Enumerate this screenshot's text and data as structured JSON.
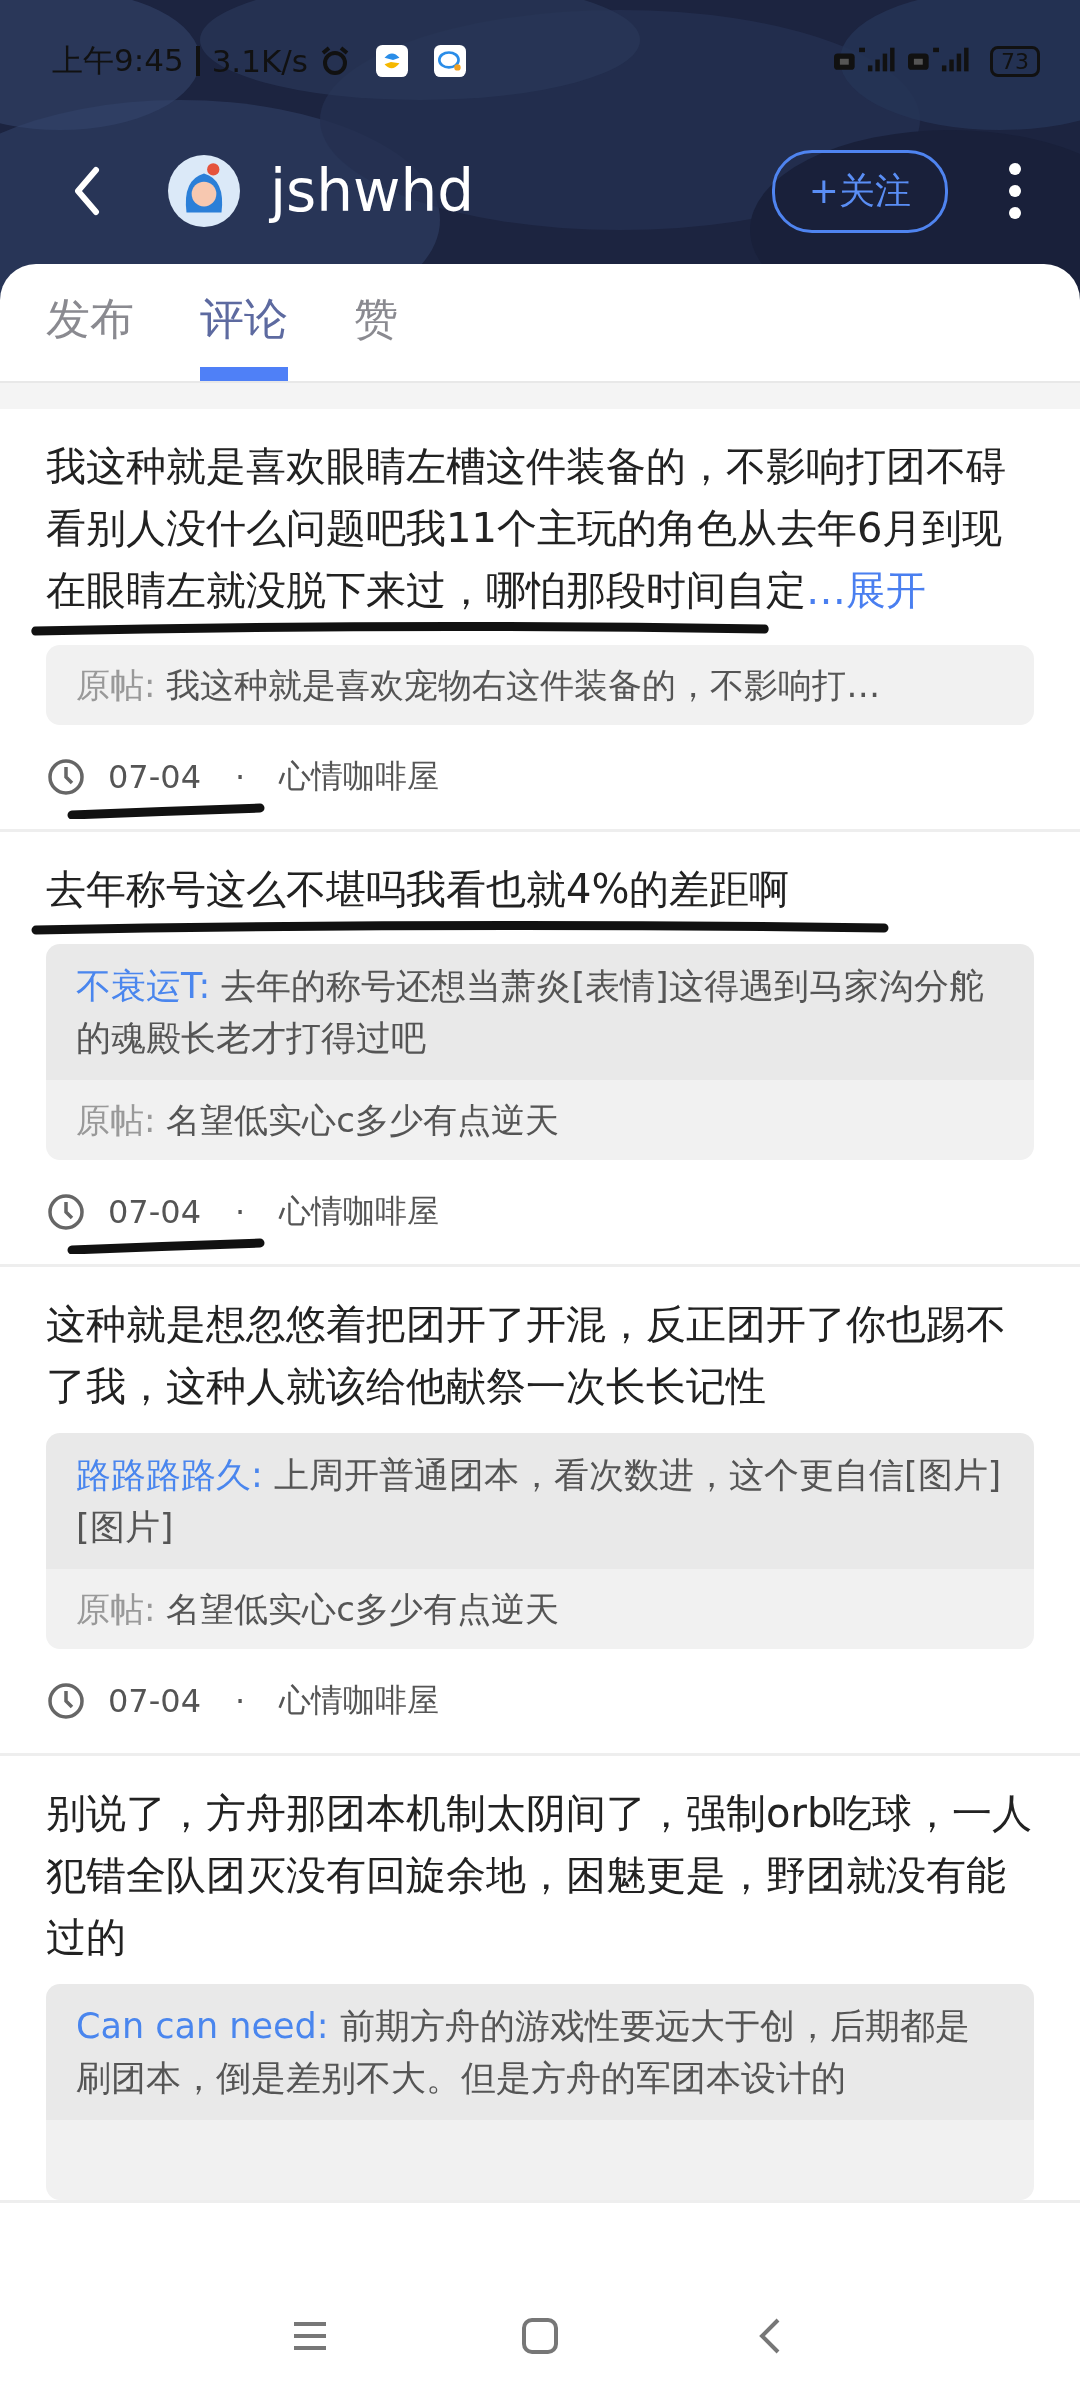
{
  "status_bar": {
    "time": "上午9:45",
    "speed": "3.1K/s",
    "battery": "73"
  },
  "header": {
    "username": "jshwhd",
    "follow_button": "+关注"
  },
  "tabs": [
    {
      "label": "发布",
      "selected": false
    },
    {
      "label": "评论",
      "selected": true
    },
    {
      "label": "赞",
      "selected": false
    }
  ],
  "comments": [
    {
      "text": "我这种就是喜欢眼睛左槽这件装备的，不影响打团不碍看别人没什么问题吧我11个主玩的角色从去年6月到现在眼睛左就没脱下来过，哪怕那段时间自定",
      "expand_link": "…展开",
      "original_label": "原帖:",
      "original_post": "我这种就是喜欢宠物右这件装备的，不影响打…",
      "date": "07-04",
      "separator": "·",
      "forum": "心情咖啡屋"
    },
    {
      "text": "去年称号这么不堪吗我看也就4%的差距啊",
      "reply": {
        "author": "不衰运T:",
        "text": "去年的称号还想当萧炎[表情]这得遇到马家沟分舵的魂殿长老才打得过吧"
      },
      "original_label": "原帖:",
      "original_post": "名望低实心c多少有点逆天",
      "date": "07-04",
      "separator": "·",
      "forum": "心情咖啡屋"
    },
    {
      "text": "这种就是想忽悠着把团开了开混，反正团开了你也踢不了我，这种人就该给他献祭一次长长记性",
      "reply": {
        "author": "路路路路久:",
        "text": "上周开普通团本，看次数进，这个更自信[图片][图片]"
      },
      "original_label": "原帖:",
      "original_post": "名望低实心c多少有点逆天",
      "date": "07-04",
      "separator": "·",
      "forum": "心情咖啡屋"
    },
    {
      "text": "别说了，方舟那团本机制太阴间了，强制orb吃球，一人犯错全队团灭没有回旋余地，困魅更是，野团就没有能过的",
      "reply": {
        "author": "Can can need:",
        "text": "前期方舟的游戏性要远大于创，后期都是刷团本，倒是差别不大。但是方舟的军团本设计的"
      }
    }
  ]
}
